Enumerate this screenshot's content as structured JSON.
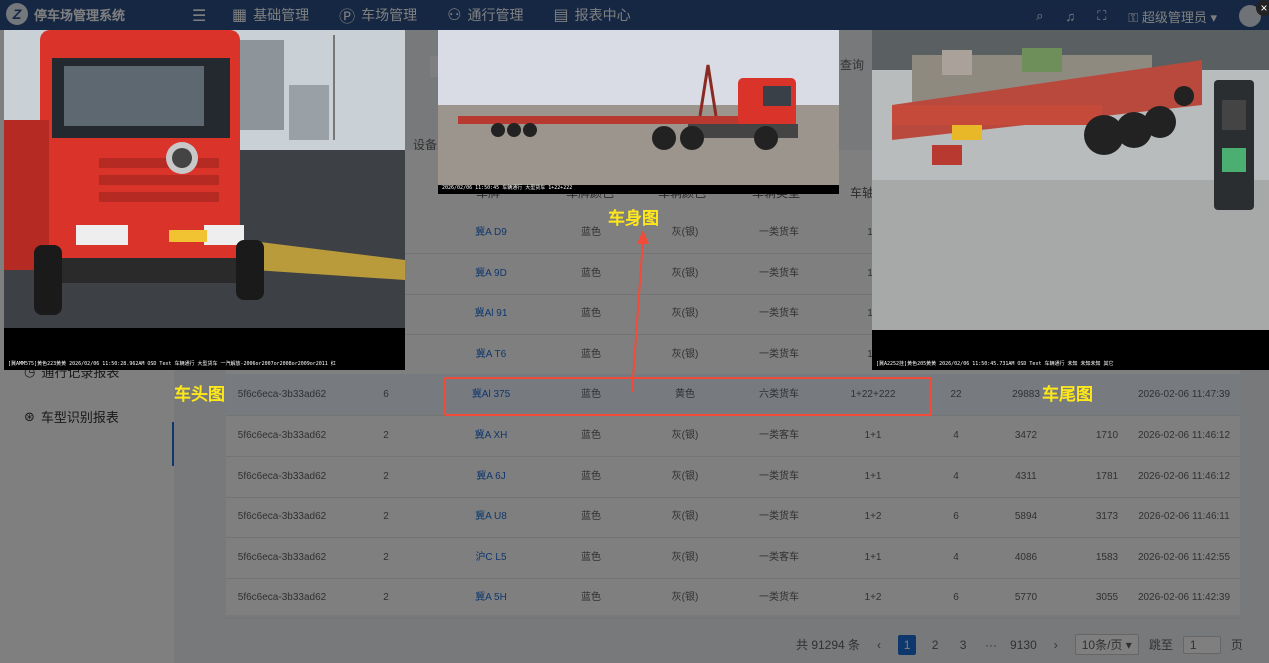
{
  "header": {
    "app_title": "停车场管理系统",
    "logo_letter": "Z",
    "menu": [
      {
        "icon": "grid-icon",
        "glyph": "▦",
        "label": "基础管理"
      },
      {
        "icon": "parking-icon",
        "glyph": "Ⓟ",
        "label": "车场管理"
      },
      {
        "icon": "people-icon",
        "glyph": "⚇",
        "label": "通行管理"
      },
      {
        "icon": "report-icon",
        "glyph": "▤",
        "label": "报表中心"
      }
    ],
    "user_name": "超级管理员"
  },
  "sidebar": {
    "items": [
      {
        "label": "通行记录报表",
        "icon": "clock-icon"
      },
      {
        "label": "车型识别报表",
        "icon": "car-recognition-icon"
      }
    ]
  },
  "main": {
    "tab_label": "车",
    "search_label": "查询",
    "filter_label": "设备"
  },
  "table": {
    "headers": [
      "车牌",
      "车牌颜色",
      "车辆颜色",
      "车辆类型",
      "车轴"
    ],
    "rows": [
      {
        "id": "",
        "count": "",
        "plate": "冀A   D9",
        "plate_color": "蓝色",
        "vehicle_color": "灰(银)",
        "vehicle_type": "一类货车",
        "axle": "1+",
        "axles": "",
        "weight": "",
        "length": "",
        "time": ""
      },
      {
        "id": "",
        "count": "",
        "plate": "冀A   9D",
        "plate_color": "蓝色",
        "vehicle_color": "灰(银)",
        "vehicle_type": "一类货车",
        "axle": "1+",
        "axles": "",
        "weight": "",
        "length": "",
        "time": ""
      },
      {
        "id": "",
        "count": "",
        "plate": "冀Al   91",
        "plate_color": "蓝色",
        "vehicle_color": "灰(银)",
        "vehicle_type": "一类货车",
        "axle": "1+",
        "axles": "",
        "weight": "",
        "length": "",
        "time": ""
      },
      {
        "id": "",
        "count": "",
        "plate": "冀A   T6",
        "plate_color": "蓝色",
        "vehicle_color": "灰(银)",
        "vehicle_type": "一类货车",
        "axle": "1+",
        "axles": "",
        "weight": "",
        "length": "",
        "time": ""
      },
      {
        "id": "5f6c6eca-3b33ad62",
        "count": "6",
        "plate": "冀Al   375",
        "plate_color": "蓝色",
        "vehicle_color": "黄色",
        "vehicle_type": "六类货车",
        "axle": "1+22+222",
        "axles": "22",
        "weight": "29883",
        "length": "",
        "time": "2026-02-06 11:47:39"
      },
      {
        "id": "5f6c6eca-3b33ad62",
        "count": "2",
        "plate": "冀A   XH",
        "plate_color": "蓝色",
        "vehicle_color": "灰(银)",
        "vehicle_type": "一类客车",
        "axle": "1+1",
        "axles": "4",
        "weight": "3472",
        "length": "1710",
        "time": "2026-02-06 11:46:12"
      },
      {
        "id": "5f6c6eca-3b33ad62",
        "count": "2",
        "plate": "冀A   6J",
        "plate_color": "蓝色",
        "vehicle_color": "灰(银)",
        "vehicle_type": "一类货车",
        "axle": "1+1",
        "axles": "4",
        "weight": "4311",
        "length": "1781",
        "time": "2026-02-06 11:46:12"
      },
      {
        "id": "5f6c6eca-3b33ad62",
        "count": "2",
        "plate": "冀A   U8",
        "plate_color": "蓝色",
        "vehicle_color": "灰(银)",
        "vehicle_type": "一类货车",
        "axle": "1+2",
        "axles": "6",
        "weight": "5894",
        "length": "3173",
        "time": "2026-02-06 11:46:11"
      },
      {
        "id": "5f6c6eca-3b33ad62",
        "count": "2",
        "plate": "沪C   L5",
        "plate_color": "蓝色",
        "vehicle_color": "灰(银)",
        "vehicle_type": "一类客车",
        "axle": "1+1",
        "axles": "4",
        "weight": "4086",
        "length": "1583",
        "time": "2026-02-06 11:42:55"
      },
      {
        "id": "5f6c6eca-3b33ad62",
        "count": "2",
        "plate": "冀A   5H",
        "plate_color": "蓝色",
        "vehicle_color": "灰(银)",
        "vehicle_type": "一类货车",
        "axle": "1+2",
        "axles": "6",
        "weight": "5770",
        "length": "3055",
        "time": "2026-02-06 11:42:39"
      }
    ]
  },
  "pagination": {
    "total": "共 91294 条",
    "pages": [
      "1",
      "2",
      "3",
      "···",
      "9130"
    ],
    "per_page": "10条/页",
    "jump_label": "跳至",
    "jump_value": "1",
    "page_suffix": "页"
  },
  "overlay": {
    "front_caption": "[冀AMM575]黄色223黄黄 2026/02/06 11:50:28.962AM OSD Text 车辆通行 大型货车 一汽解放-2006or2007or2008or2009or2011 红",
    "side_caption": "2026/02/06 11:50:45 车辆通行 大型货车 1+22+222",
    "rear_caption": "[冀A2252挂]黄色205黄黄 2026/02/06 11:50:45.731AM OSD Text 车辆通行 未知 未知未知 其它",
    "label_front": "车头图",
    "label_side": "车身图",
    "label_rear": "车尾图",
    "close_glyph": "×"
  },
  "colors": {
    "header_bg": "#2b4f86",
    "accent_blue": "#1d6fdc",
    "annotation_yellow": "#ffe81a",
    "highlight_red": "#f24b3a",
    "truck_red": "#d9332a"
  }
}
